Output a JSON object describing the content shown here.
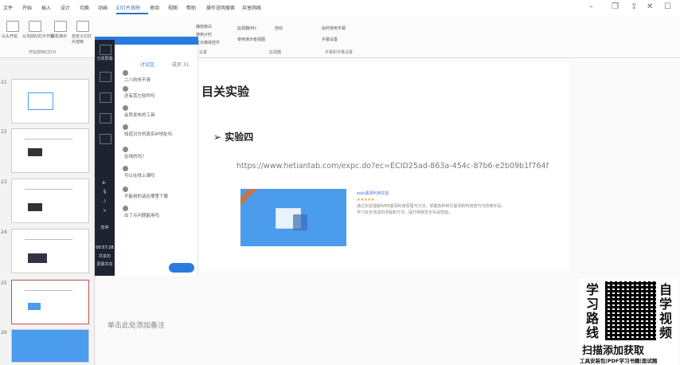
{
  "tabs": [
    "文件",
    "开始",
    "插入",
    "设计",
    "切换",
    "动画",
    "幻灯片放映",
    "审阅",
    "视图",
    "帮助",
    "操作说明搜索",
    "共享网络"
  ],
  "active_tab": "幻灯片放映",
  "ribbon": {
    "buttons": [
      "从头开始",
      "从当前幻灯片开始",
      "联机演示",
      "自定义幻灯片放映"
    ],
    "group_labels": [
      "开始放映幻灯片",
      "设置",
      "监视器",
      "字幕和字幕设置"
    ],
    "right_items": [
      "播放旁白",
      "使用计时",
      "显示媒体控件",
      "监视器(M):",
      "自动",
      "使用演示者视图",
      "始终使用字幕",
      "字幕设置"
    ]
  },
  "thumbs": {
    "numbers": [
      "21",
      "22",
      "23",
      "24",
      "25",
      "26"
    ],
    "selected": "25"
  },
  "sidebar": {
    "top_label": "分享屏幕",
    "timer": "00:57:28",
    "bottom_text": [
      "暂停",
      "共享的",
      "屏幕共享"
    ]
  },
  "chat": {
    "tabs": [
      "讨论区",
      "成员 31"
    ],
    "messages": [
      "二八的听不清",
      "还有其它软件吗",
      "会员发布的工具",
      "知道对方的真实IP地址吗",
      "在线的吗？",
      "可以在线上课吗",
      "不能用的话在哪里下载",
      "出了点问题能用吗"
    ]
  },
  "slide": {
    "title": "目关实验",
    "subtitle": "➢ 实验四",
    "url": "https://www.hetiantab.com/expc.do?ec=ECID25ad-863a-454c-87b6-e2b09b1f764f",
    "card_title": "web漏洞利用实验",
    "card_desc": "通过实验理解WEB漏洞利用原理与方法，掌握各种常见漏洞的利用技巧与防御手段，学习安全测试的流程和方法，提升网络安全实战技能。"
  },
  "notes_placeholder": "单击此处添加备注",
  "promo": {
    "left_chars": [
      "学",
      "习",
      "路",
      "线"
    ],
    "right_chars": [
      "自",
      "学",
      "视",
      "频"
    ],
    "title": "扫描添加获取",
    "subtitle": "工具安装包|PDF学习书籍|面试题"
  }
}
